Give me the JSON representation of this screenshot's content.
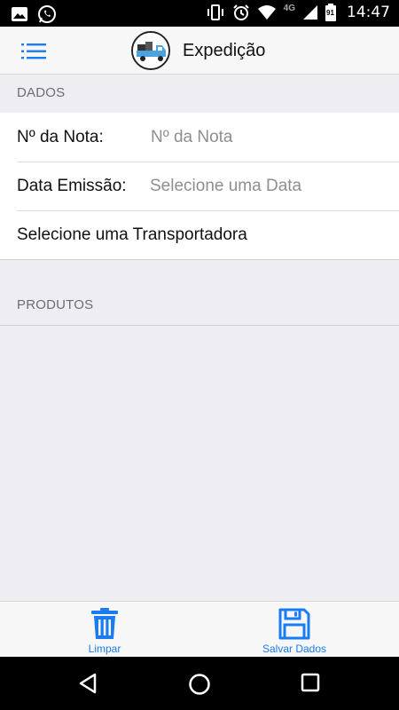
{
  "status_bar": {
    "time": "14:47",
    "network": "4G",
    "battery_level_text": "91",
    "icons": [
      "image-icon",
      "whatsapp-icon",
      "vibrate-icon",
      "alarm-icon",
      "wifi-icon",
      "signal-icon",
      "battery-icon"
    ]
  },
  "header": {
    "title": "Expedição",
    "menu_icon": "list-menu-icon",
    "logo": "truck-logo"
  },
  "sections": {
    "dados": "DADOS",
    "produtos": "PRODUTOS"
  },
  "form": {
    "nota_label": "Nº da Nota:",
    "nota_placeholder": "Nº da Nota",
    "nota_value": "",
    "data_label": "Data Emissão:",
    "data_placeholder": "Selecione uma Data",
    "data_value": "",
    "transportadora_label": "Selecione uma Transportadora"
  },
  "toolbar": {
    "limpar_label": "Limpar",
    "salvar_label": "Salvar Dados",
    "accent": "#1a7cf3"
  },
  "nav": {
    "icons": [
      "back-icon",
      "home-icon",
      "recents-icon"
    ]
  }
}
